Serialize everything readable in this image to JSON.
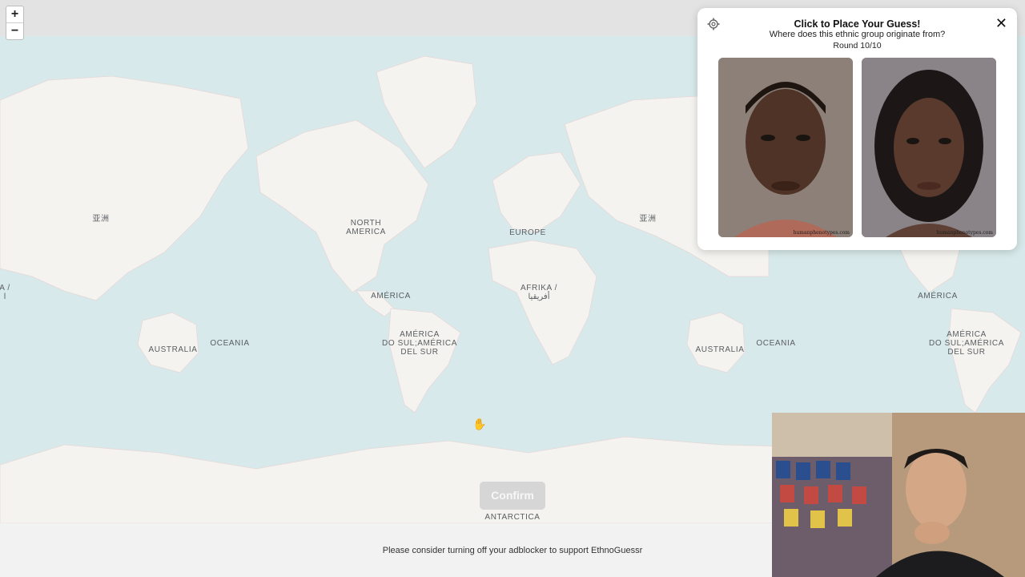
{
  "zoom": {
    "in_label": "+",
    "out_label": "−"
  },
  "map": {
    "labels": {
      "asia_cn_left": "亚洲",
      "north_america": "NORTH\nAMERICA",
      "europe": "EUROPE",
      "asia_cn_right": "亚洲",
      "asia_ar_left": "A /\nا",
      "america_center": "AMÉRICA",
      "afrika": "AFRIKA /\nأفريقيا",
      "america_right": "AMÉRICA",
      "australia_left": "AUSTRALIA",
      "oceania_left": "OCEANIA",
      "south_america_center": "AMÉRICA\nDO SUL;AMÉRICA\nDEL SUR",
      "australia_right": "AUSTRALIA",
      "oceania_right": "OCEANIA",
      "south_america_right": "AMÉRICA\nDO SUL;AMÉRICA\nDEL SUR",
      "antarctica": "ANTARCTICA"
    }
  },
  "panel": {
    "title": "Click to Place Your Guess!",
    "question": "Where does this ethnic group originate from?",
    "round": "Round 10/10",
    "close_label": "✕",
    "faces": [
      {
        "credit": "humanphenotypes.com"
      },
      {
        "credit": "humanphenotypes.com"
      }
    ]
  },
  "confirm_label": "Confirm",
  "footer": {
    "message": "Please consider turning off your adblocker to support EthnoGuessr"
  },
  "colors": {
    "ocean": "#d7e9ea",
    "land": "#f4f3ef",
    "topbar": "#e3e3e3",
    "confirm": "#d6d6d6"
  }
}
